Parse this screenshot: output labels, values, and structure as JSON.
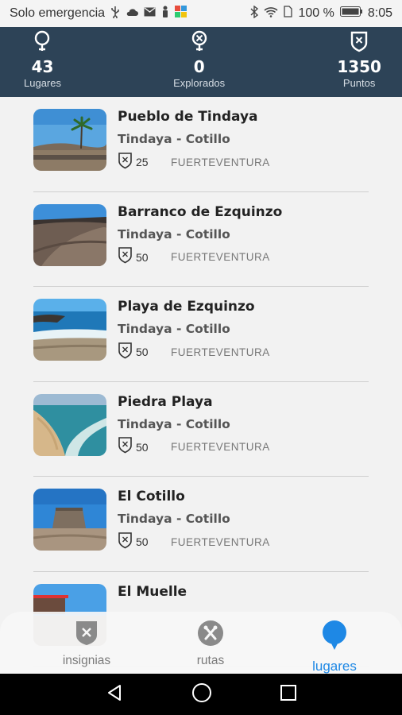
{
  "status_bar": {
    "carrier": "Solo emergencia",
    "battery": "100 %",
    "time": "8:05"
  },
  "stats": [
    {
      "value": "43",
      "label": "Lugares",
      "icon": "map-pin-icon"
    },
    {
      "value": "0",
      "label": "Explorados",
      "icon": "explored-pin-icon"
    },
    {
      "value": "1350",
      "label": "Puntos",
      "icon": "shield-badge-icon"
    }
  ],
  "places": [
    {
      "title": "Pueblo de Tindaya",
      "area": "Tindaya - Cotillo",
      "points": "25",
      "region": "FUERTEVENTURA"
    },
    {
      "title": "Barranco de Ezquinzo",
      "area": "Tindaya - Cotillo",
      "points": "50",
      "region": "FUERTEVENTURA"
    },
    {
      "title": "Playa de Ezquinzo",
      "area": "Tindaya - Cotillo",
      "points": "50",
      "region": "FUERTEVENTURA"
    },
    {
      "title": "Piedra Playa",
      "area": "Tindaya - Cotillo",
      "points": "50",
      "region": "FUERTEVENTURA"
    },
    {
      "title": "El Cotillo",
      "area": "Tindaya - Cotillo",
      "points": "50",
      "region": "FUERTEVENTURA"
    },
    {
      "title": "El Muelle",
      "area": "",
      "points": "",
      "region": ""
    }
  ],
  "bottom_nav": [
    {
      "label": "insignias",
      "icon": "shield-badge-icon",
      "active": false
    },
    {
      "label": "rutas",
      "icon": "routes-icon",
      "active": false
    },
    {
      "label": "lugares",
      "icon": "location-pin-icon",
      "active": true
    }
  ],
  "colors": {
    "header_bg": "#2d4357",
    "accent": "#1e88e5",
    "list_bg": "#f2f2f2"
  }
}
